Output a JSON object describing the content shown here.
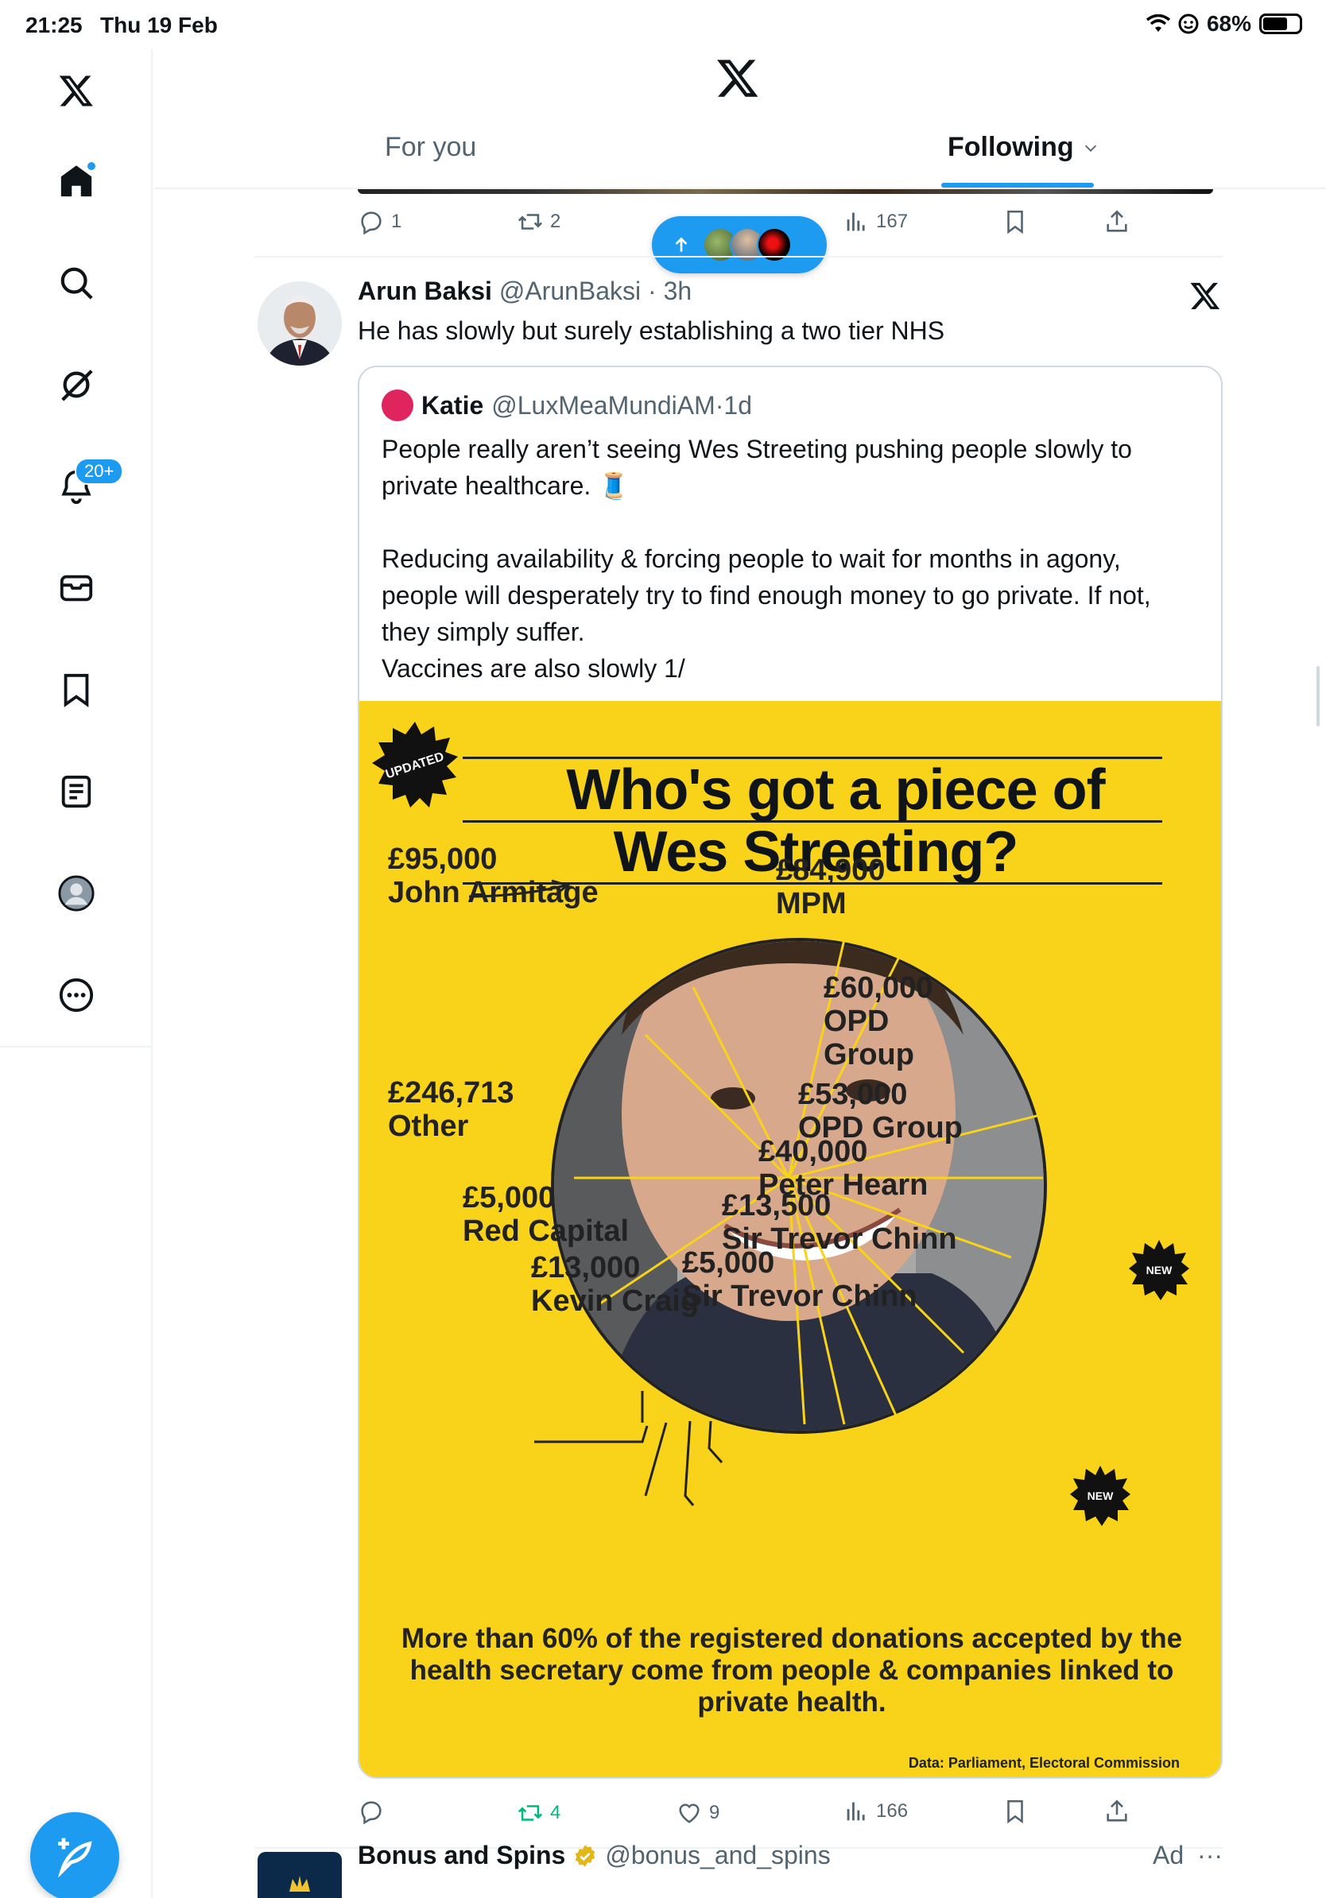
{
  "status_bar": {
    "time": "21:25",
    "date": "Thu 19 Feb",
    "battery": "68%",
    "battery_level": 0.68
  },
  "sidebar": {
    "items": [
      {
        "name": "x-logo"
      },
      {
        "name": "home",
        "has_dot": true
      },
      {
        "name": "search"
      },
      {
        "name": "grok"
      },
      {
        "name": "notifications",
        "badge": "20+"
      },
      {
        "name": "messages"
      },
      {
        "name": "bookmarks"
      },
      {
        "name": "lists"
      },
      {
        "name": "profile"
      },
      {
        "name": "more"
      }
    ],
    "compose_icon": "compose-icon"
  },
  "header": {
    "tabs": [
      {
        "label": "For you",
        "selected": false
      },
      {
        "label": "Following",
        "selected": true
      }
    ]
  },
  "accent_color": "#1d9bf0",
  "previous_post_actions": {
    "replies": "1",
    "reposts": "2",
    "views": "167"
  },
  "new_posts_pill": {
    "icon": "arrow-up-icon"
  },
  "post": {
    "author_name": "Arun Baksi",
    "handle": "@ArunBaksi",
    "time": "3h",
    "text": "He has slowly but surely establishing a two tier NHS",
    "quote": {
      "author_name": "Katie",
      "handle": "@LuxMeaMundiAM",
      "time": "1d",
      "paragraphs": [
        "People really aren’t seeing Wes Streeting pushing people slowly to private healthcare. 🧵",
        "",
        "Reducing availability & forcing people to wait for months in agony, people will desperately try to find enough money to go private. If not, they simply suffer.",
        "Vaccines are also slowly 1/"
      ],
      "image": {
        "badge": "UPDATED",
        "title_line1": "Who's got a piece of",
        "title_line2": "Wes Streeting?",
        "labels": [
          {
            "amount": "£95,000",
            "name": "John Armitage"
          },
          {
            "amount": "£84,900",
            "name": "MPM"
          },
          {
            "amount": "£60,000",
            "name": "OPD Group",
            "name_line1": "OPD",
            "name_line2": "Group"
          },
          {
            "amount": "£53,000",
            "name": "OPD Group",
            "new": true
          },
          {
            "amount": "£40,000",
            "name": "Peter Hearn"
          },
          {
            "amount": "£13,500",
            "name": "Sir Trevor Chinn"
          },
          {
            "amount": "£5,000",
            "name": "Sir Trevor Chinn",
            "new": true
          },
          {
            "amount": "£13,000",
            "name": "Kevin Craig"
          },
          {
            "amount": "£5,000",
            "name": "Red Capital"
          },
          {
            "amount": "£246,713",
            "name": "Other"
          }
        ],
        "new_badge": "NEW",
        "footer": "More than 60% of the registered donations accepted by the health secretary come from people & companies linked to private health.",
        "credit": "Data: Parliament, Electoral Commission"
      }
    },
    "actions": {
      "replies": "",
      "reposts": "4",
      "likes": "9",
      "views": "166"
    }
  },
  "ad": {
    "author_name": "Bonus and Spins",
    "handle": "@bonus_and_spins",
    "label": "Ad",
    "more": "···"
  }
}
